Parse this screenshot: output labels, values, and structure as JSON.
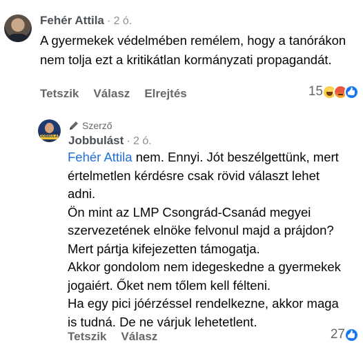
{
  "comment": {
    "author": "Fehér Attila",
    "separator": "·",
    "time": "2 ó.",
    "text": "A gyermekek védelmében remélem, hogy a tanórákon nem tolja ezt a kritikátlan kormányzati propagandát.",
    "actions": {
      "like": "Tetszik",
      "reply": "Válasz",
      "hide": "Elrejtés"
    },
    "reaction_count": "15",
    "reaction_icons": [
      "haha-icon",
      "angry-icon",
      "like-icon"
    ]
  },
  "reply": {
    "badge": "Szerző",
    "author": "Jobbulást",
    "avatar_text": "JOBBULÁST",
    "separator": "·",
    "time": "2 ó.",
    "mention": "Fehér Attila",
    "lines": [
      " nem. Ennyi. Jót beszélgettünk, mert",
      "értelmetlen kérdésre csak rövid választ lehet",
      "adni.",
      "Ön mint az LMP Csongrád-Csanád megyei",
      "szervezetének elnöke felvonul majd a prájdon?",
      "Mert pártja kifejezetten támogatja.",
      "Akkor gondolom nem idegeskedne a gyermekek",
      "jogaiért. Őket nem tőlem kell félteni.",
      "Ha egy pici jóérzéssel rendelkezne, akkor maga",
      "is tudná. De ne várjuk lehetetlent."
    ],
    "actions": {
      "like": "Tetszik",
      "reply": "Válasz"
    },
    "reaction_count": "27",
    "reaction_icons": [
      "like-icon"
    ]
  }
}
